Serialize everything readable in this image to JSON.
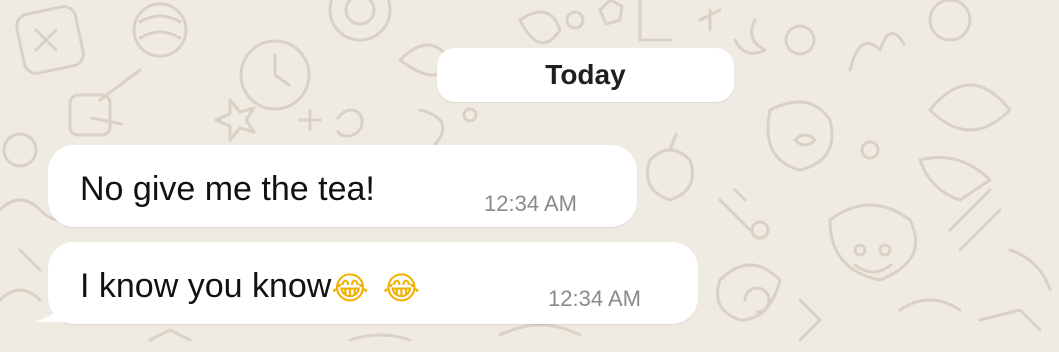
{
  "chat": {
    "date_label": "Today",
    "messages": [
      {
        "text": "No give me the tea!",
        "time": "12:34 AM"
      },
      {
        "text": "I know you know",
        "emojis": [
          "😂",
          "😂"
        ],
        "time": "12:34 AM"
      }
    ]
  },
  "colors": {
    "background": "#efeae2",
    "bubble": "#ffffff",
    "timestamp": "#8a8a8a"
  }
}
